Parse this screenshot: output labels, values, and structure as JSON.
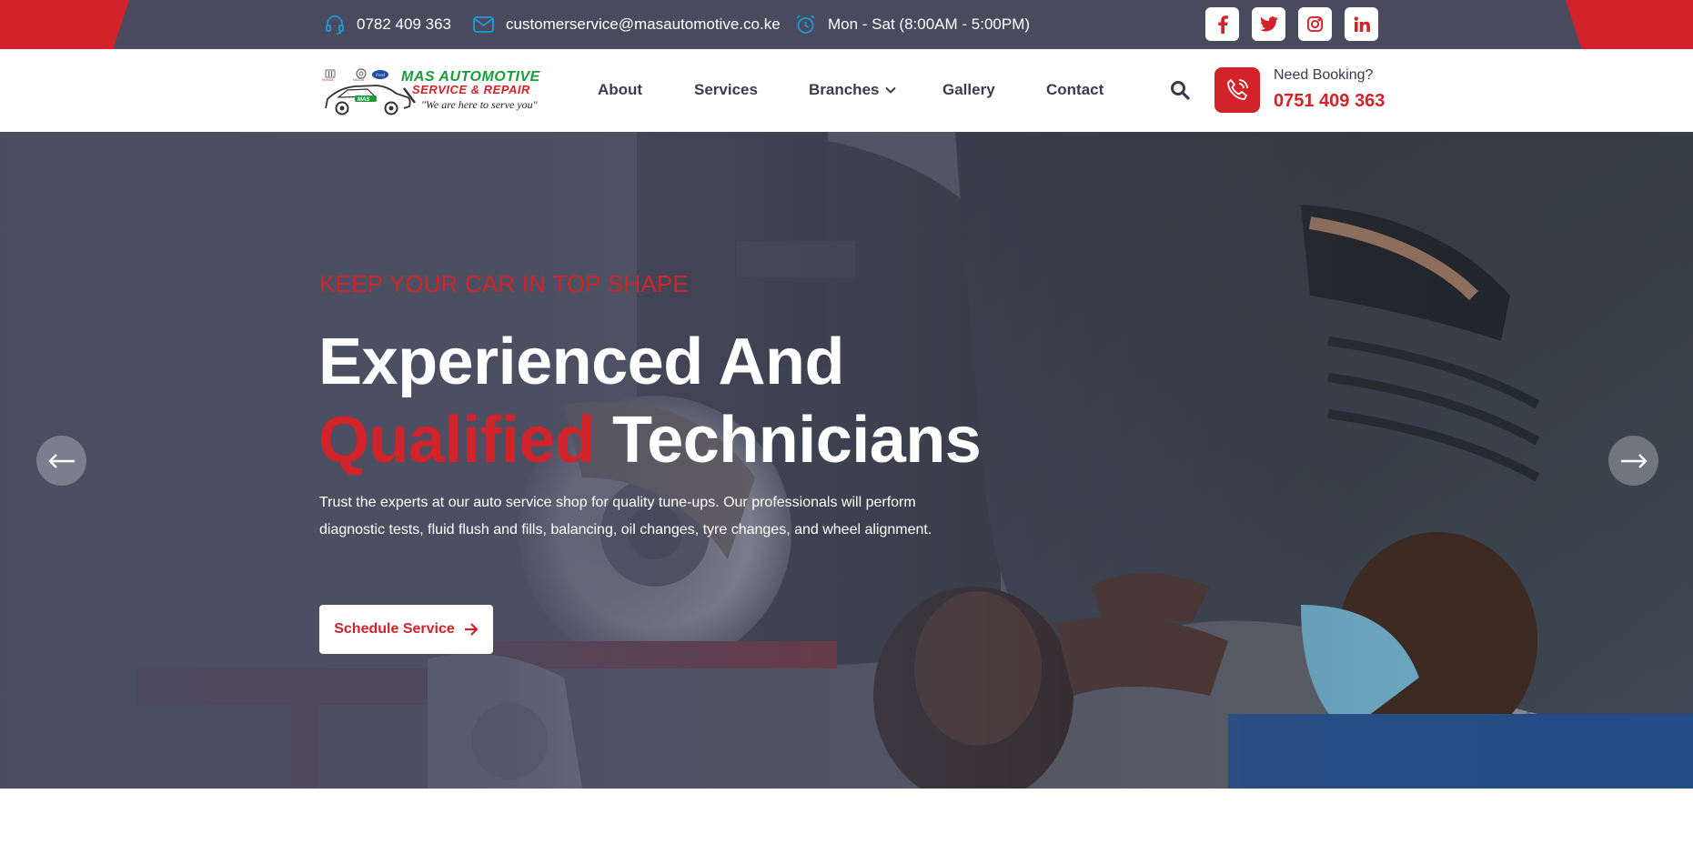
{
  "topbar": {
    "phone": "0782 409 363",
    "email": "customerservice@masautomotive.co.ke",
    "hours": "Mon - Sat (8:00AM - 5:00PM)",
    "socials": [
      "f",
      "twitter",
      "instagram",
      "in"
    ]
  },
  "header": {
    "logo_line1": "MAS AUTOMOTIVE",
    "logo_line2": "SERVICE & REPAIR",
    "logo_tagline": "\"We are here to serve you\"",
    "nav": [
      "About",
      "Services",
      "Branches",
      "Gallery",
      "Contact"
    ],
    "booking_label": "Need Booking?",
    "booking_phone": "0751 409 363"
  },
  "hero": {
    "kicker": "KEEP YOUR CAR IN TOP SHAPE",
    "headline_line1": "Experienced And",
    "headline_red": "Qualified",
    "headline_rest": " Technicians",
    "description": "Trust the experts at our auto service shop for quality tune-ups. Our professionals will perform diagnostic tests, fluid flush and fills, balancing, oil changes, tyre changes, and wheel alignment.",
    "cta": "Schedule Service"
  },
  "colors": {
    "brand_red": "#d2232a",
    "dark_slate": "#494a5e",
    "accent_blue": "#1e9bd7",
    "logo_green": "#1c9a3c"
  }
}
